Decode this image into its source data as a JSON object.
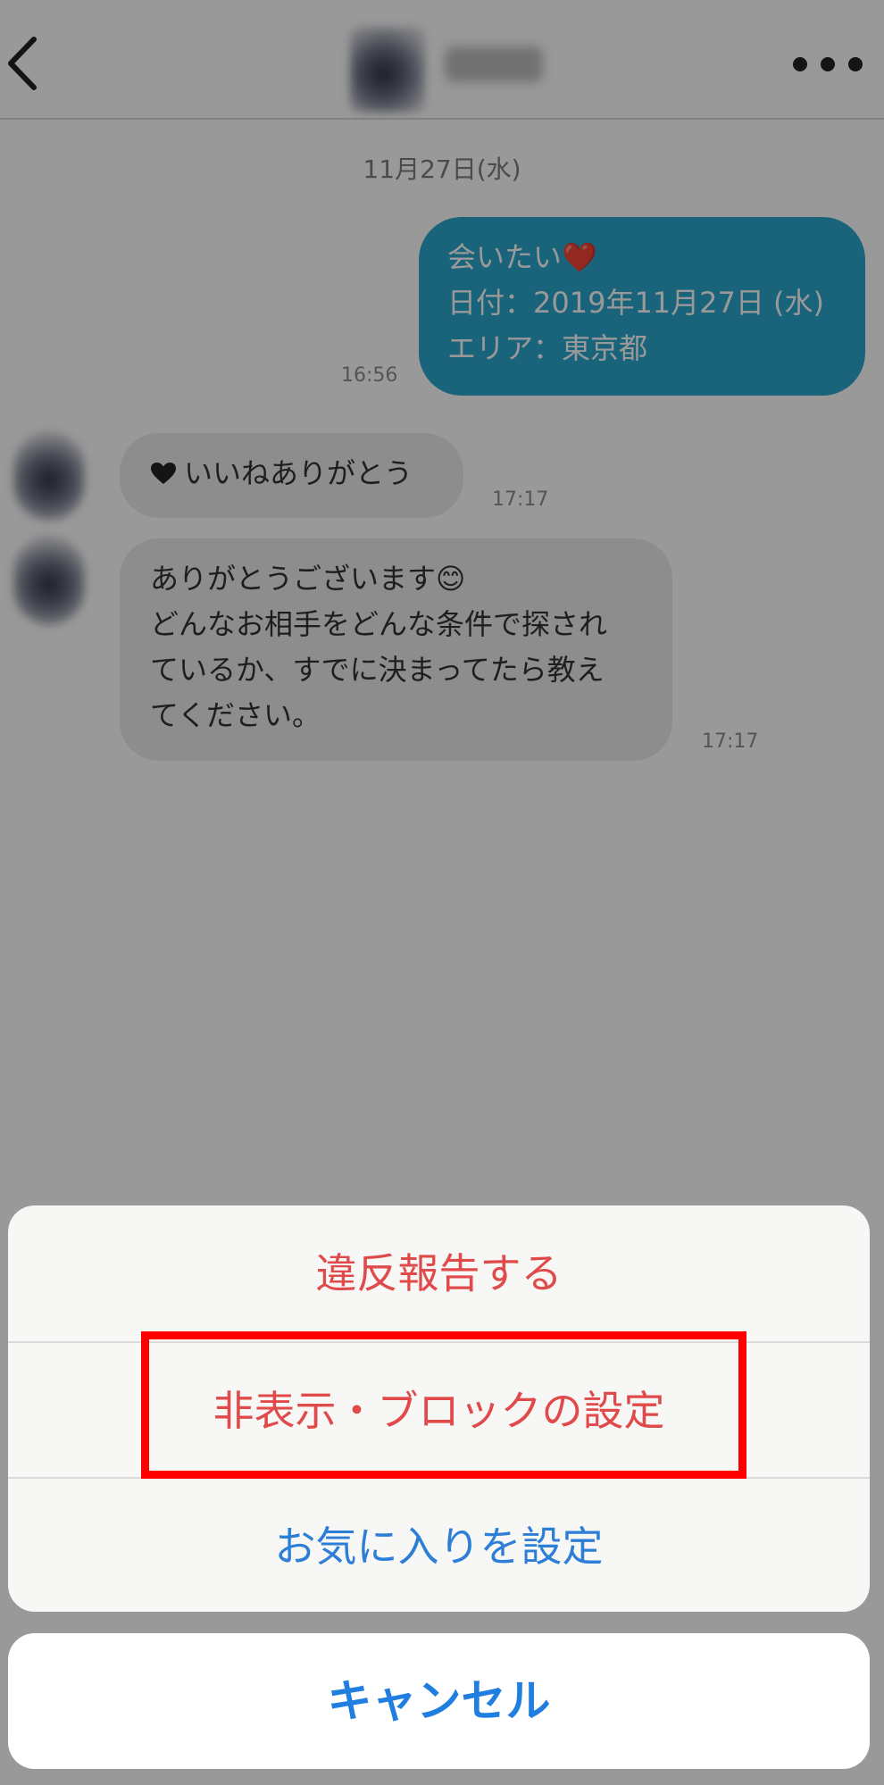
{
  "header": {
    "back_icon": "chevron-left-icon",
    "more_icon": "ellipsis-icon"
  },
  "chat": {
    "date_divider": "11月27日(水)",
    "sent_message": {
      "lines": [
        "会いたい❤️",
        "日付：2019年11月27日 (水)",
        "エリア：東京都"
      ],
      "time": "16:56",
      "color": "#2ca7cd"
    },
    "received_messages": [
      {
        "text": "いいねありがとう",
        "icon": "heart-icon",
        "time": "17:17"
      },
      {
        "lines": [
          "ありがとうございます😊",
          "どんなお相手をどんな条件で探され",
          "ているか、すでに決まってたら教え",
          "てください。"
        ],
        "time": "17:17"
      }
    ]
  },
  "action_sheet": {
    "items": [
      {
        "label": "違反報告する",
        "color": "#e04a4a"
      },
      {
        "label": "非表示・ブロックの設定",
        "color": "#e04a4a",
        "highlighted": true
      },
      {
        "label": "お気に入りを設定",
        "color": "#2d7ed6"
      }
    ],
    "cancel_label": "キャンセル",
    "highlight_color": "#ff0000"
  }
}
